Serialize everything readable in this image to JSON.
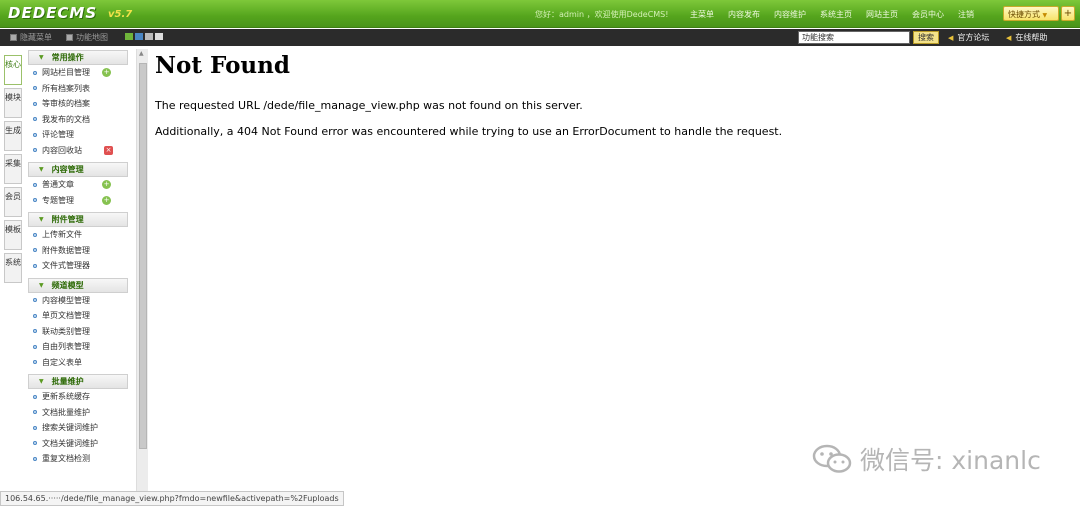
{
  "header": {
    "logo": "DEDECMS",
    "version": "v5.7",
    "welcome": "您好：admin ，欢迎使用DedeCMS!",
    "nav": [
      "主菜单",
      "内容发布",
      "内容维护",
      "系统主页",
      "网站主页",
      "会员中心",
      "注销"
    ],
    "quick_menu": "快捷方式",
    "quick_plus": "+"
  },
  "subbar": {
    "hide_menu": "隐藏菜单",
    "site_map": "功能地图",
    "skin_colors": [
      "#6fb43a",
      "#4a86c4",
      "#bbbbbb",
      "#dddddd"
    ],
    "search_value": "功能搜索",
    "search_button": "搜索",
    "forum": "官方论坛",
    "help": "在线帮助"
  },
  "vtabs": [
    "核心",
    "模块",
    "生成",
    "采集",
    "会员",
    "模板",
    "系统"
  ],
  "menu": {
    "groups": [
      {
        "title": "常用操作",
        "items": [
          "网站栏目管理",
          "所有档案列表",
          "等审核的档案",
          "我发布的文档",
          "评论管理",
          "内容回收站"
        ]
      },
      {
        "title": "内容管理",
        "items": [
          "普通文章",
          "专题管理"
        ]
      },
      {
        "title": "附件管理",
        "items": [
          "上传新文件",
          "附件数据管理",
          "文件式管理器"
        ]
      },
      {
        "title": "频道模型",
        "items": [
          "内容模型管理",
          "单页文档管理",
          "联动类别管理",
          "自由列表管理",
          "自定义表单"
        ]
      },
      {
        "title": "批量维护",
        "items": [
          "更新系统缓存",
          "文档批量维护",
          "搜索关键词维护",
          "文档关键词维护",
          "重复文档检测"
        ]
      }
    ]
  },
  "content": {
    "title": "Not Found",
    "line1": "The requested URL /dede/file_manage_view.php was not found on this server.",
    "line2": "Additionally, a 404 Not Found error was encountered while trying to use an ErrorDocument to handle the request."
  },
  "watermark": "微信号: xinanlc",
  "status_url": "106.54.65.·····/dede/file_manage_view.php?fmdo=newfile&activepath=%2Fuploads"
}
